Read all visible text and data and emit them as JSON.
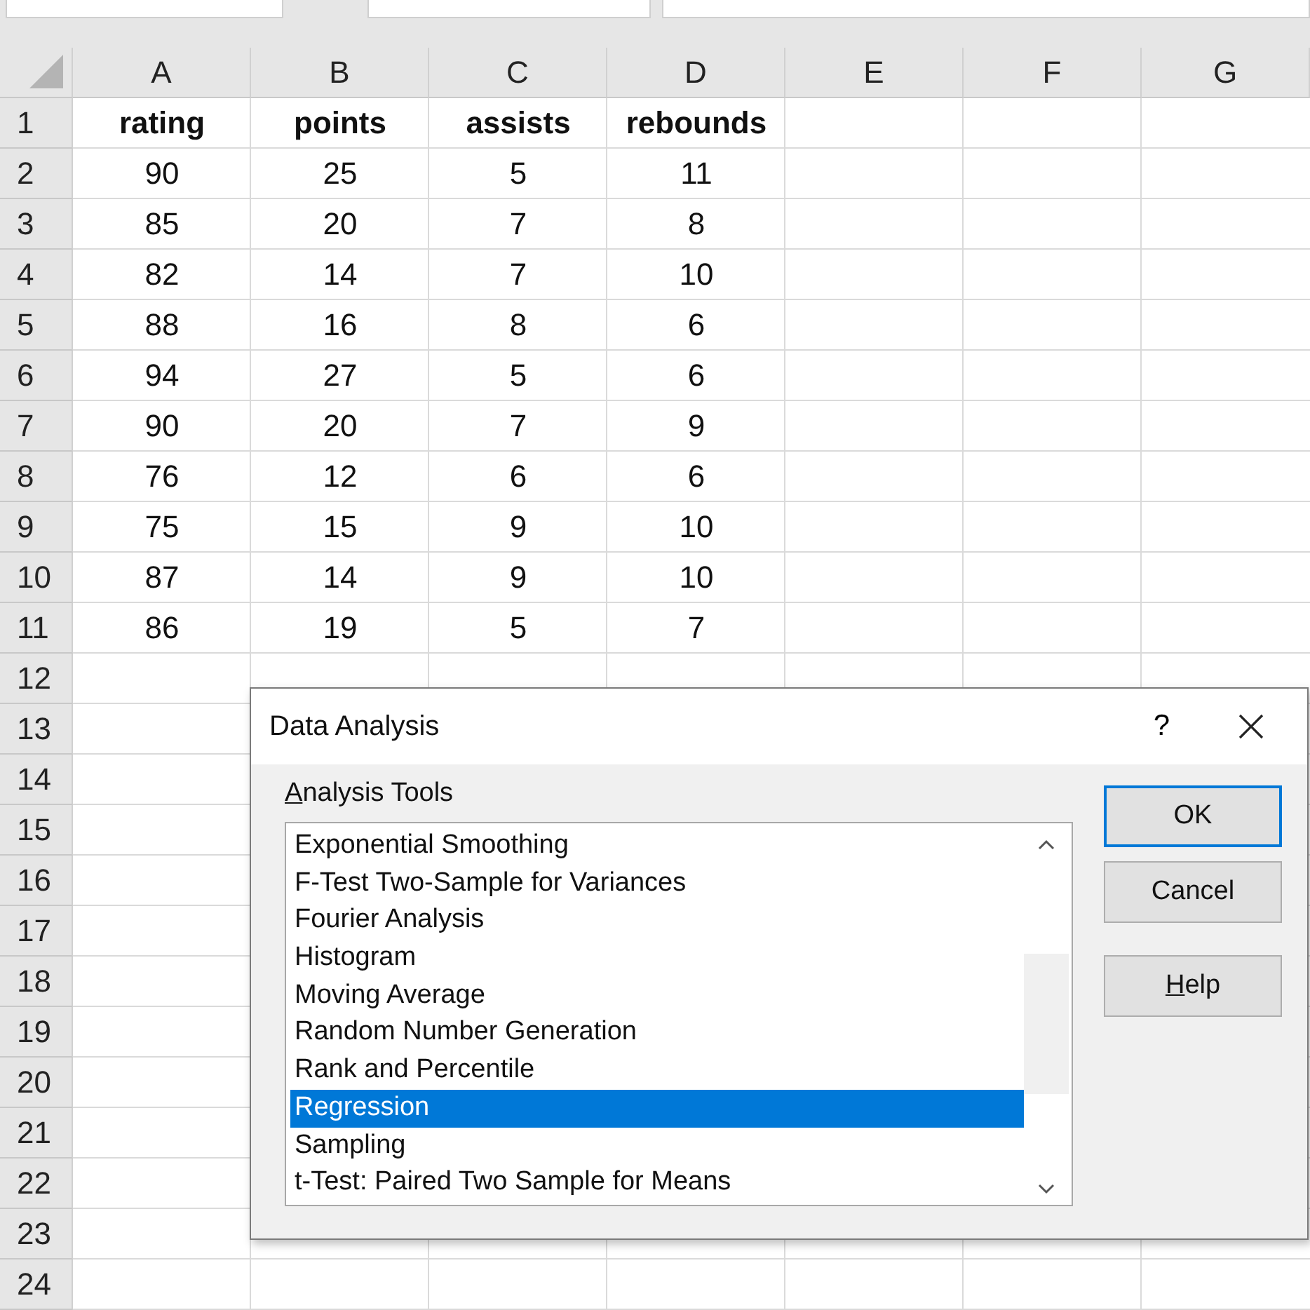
{
  "sheet": {
    "columns": [
      "A",
      "B",
      "C",
      "D",
      "E",
      "F",
      "G"
    ],
    "row_numbers": [
      "1",
      "2",
      "3",
      "4",
      "5",
      "6",
      "7",
      "8",
      "9",
      "10",
      "11",
      "12",
      "13",
      "14",
      "15",
      "16",
      "17",
      "18",
      "19",
      "20",
      "21",
      "22",
      "23",
      "24"
    ],
    "rows": [
      {
        "cells": [
          "rating",
          "points",
          "assists",
          "rebounds"
        ],
        "bold": true
      },
      {
        "cells": [
          "90",
          "25",
          "5",
          "11"
        ],
        "bold": false
      },
      {
        "cells": [
          "85",
          "20",
          "7",
          "8"
        ],
        "bold": false
      },
      {
        "cells": [
          "82",
          "14",
          "7",
          "10"
        ],
        "bold": false
      },
      {
        "cells": [
          "88",
          "16",
          "8",
          "6"
        ],
        "bold": false
      },
      {
        "cells": [
          "94",
          "27",
          "5",
          "6"
        ],
        "bold": false
      },
      {
        "cells": [
          "90",
          "20",
          "7",
          "9"
        ],
        "bold": false
      },
      {
        "cells": [
          "76",
          "12",
          "6",
          "6"
        ],
        "bold": false
      },
      {
        "cells": [
          "75",
          "15",
          "9",
          "10"
        ],
        "bold": false
      },
      {
        "cells": [
          "87",
          "14",
          "9",
          "10"
        ],
        "bold": false
      },
      {
        "cells": [
          "86",
          "19",
          "5",
          "7"
        ],
        "bold": false
      }
    ]
  },
  "dialog": {
    "title": "Data Analysis",
    "help_glyph": "?",
    "list_label": "Analysis Tools",
    "tools": [
      {
        "label": "Exponential Smoothing",
        "selected": false
      },
      {
        "label": "F-Test Two-Sample for Variances",
        "selected": false
      },
      {
        "label": "Fourier Analysis",
        "selected": false
      },
      {
        "label": "Histogram",
        "selected": false
      },
      {
        "label": "Moving Average",
        "selected": false
      },
      {
        "label": "Random Number Generation",
        "selected": false
      },
      {
        "label": "Rank and Percentile",
        "selected": false
      },
      {
        "label": "Regression",
        "selected": true
      },
      {
        "label": "Sampling",
        "selected": false
      },
      {
        "label": "t-Test: Paired Two Sample for Means",
        "selected": false
      }
    ],
    "buttons": [
      {
        "label": "OK",
        "default": true
      },
      {
        "label": "Cancel",
        "default": false
      },
      {
        "label": "Help",
        "default": false
      }
    ]
  }
}
